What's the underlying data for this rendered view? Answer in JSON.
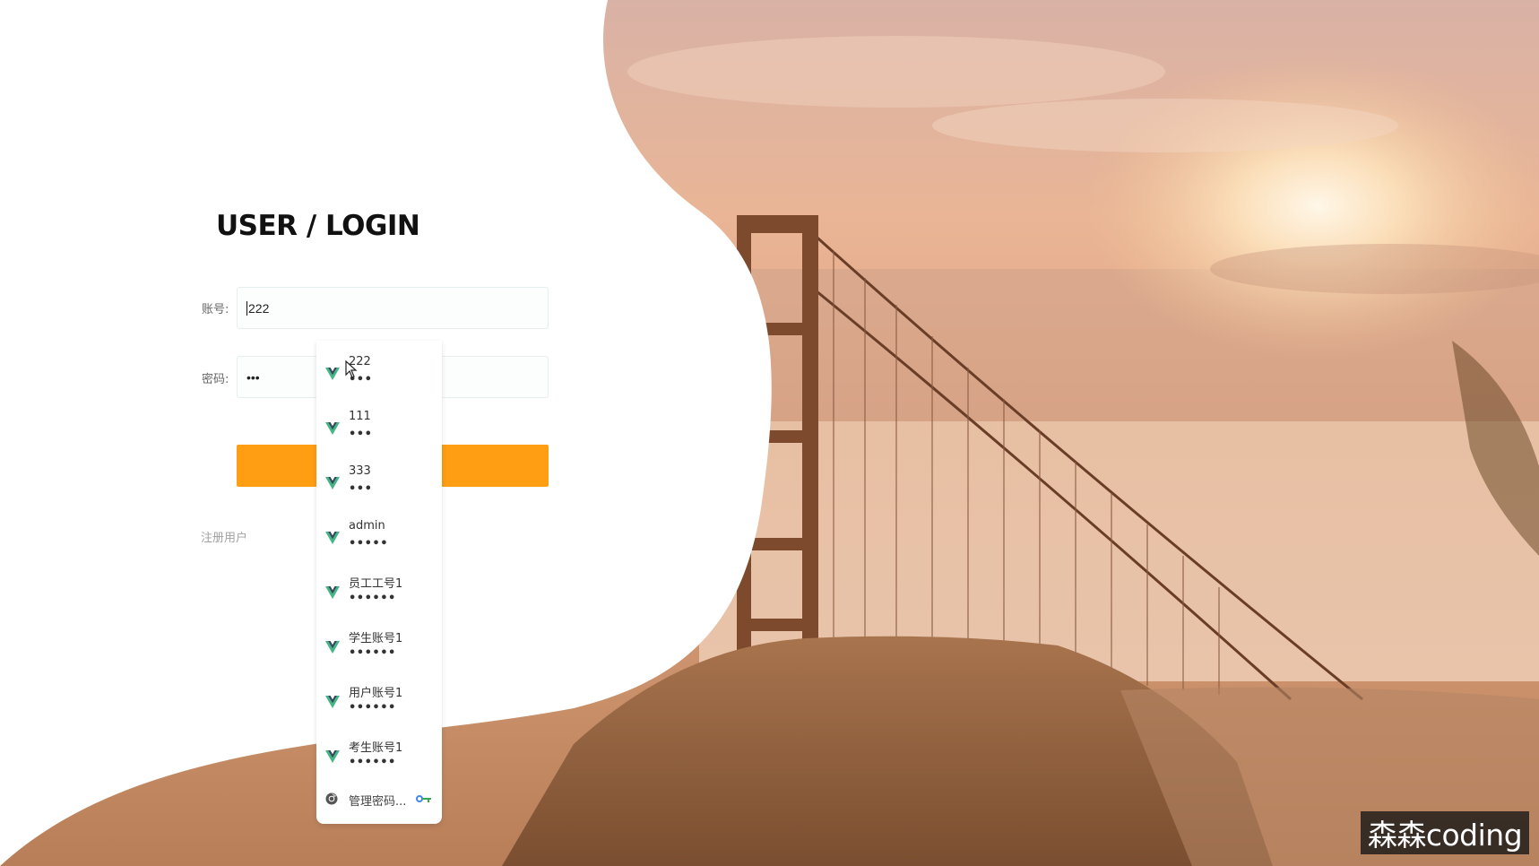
{
  "login": {
    "title": "USER / LOGIN",
    "account_label": "账号:",
    "account_value": "222",
    "password_label": "密码:",
    "password_value": "•••",
    "register_link": "注册用户"
  },
  "autofill": {
    "items": [
      {
        "username": "222",
        "password": "•••",
        "icon": "vue-logo-icon"
      },
      {
        "username": "111",
        "password": "•••",
        "icon": "vue-logo-icon"
      },
      {
        "username": "333",
        "password": "•••",
        "icon": "vue-logo-icon"
      },
      {
        "username": "admin",
        "password": "•••••",
        "icon": "vue-logo-icon"
      },
      {
        "username": "员工工号1",
        "password": "••••••",
        "icon": "vue-logo-icon"
      },
      {
        "username": "学生账号1",
        "password": "••••••",
        "icon": "vue-logo-icon"
      },
      {
        "username": "用户账号1",
        "password": "••••••",
        "icon": "vue-logo-icon"
      },
      {
        "username": "考生账号1",
        "password": "••••••",
        "icon": "vue-logo-icon"
      }
    ],
    "manage_label": "管理密码..."
  },
  "watermark": "森森coding",
  "colors": {
    "accent": "#ff9d13",
    "vue_green": "#41b883",
    "vue_dark": "#35495e"
  }
}
